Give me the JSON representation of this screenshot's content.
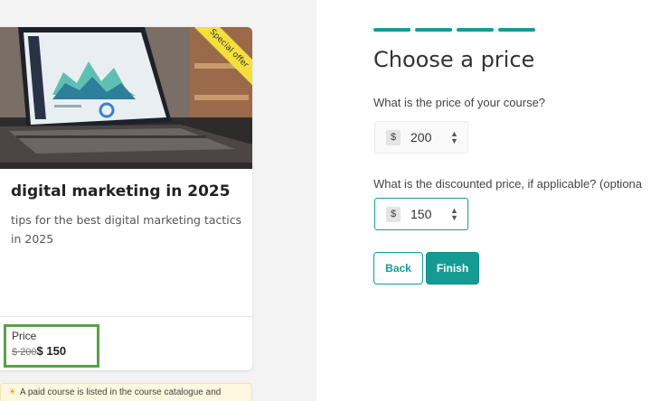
{
  "course_card": {
    "ribbon": "Special offer",
    "title": "digital marketing in 2025",
    "description": "tips for the best digital marketing tactics in 2025",
    "price_label": "Price",
    "original_price": "$ 200",
    "discounted_price": "$ 150",
    "notice": "A paid course is listed in the course catalogue and"
  },
  "form": {
    "title": "Choose a price",
    "price_question": "What is the price of your course?",
    "discount_question": "What is the discounted price, if applicable? (optiona",
    "price": {
      "currency": "$",
      "value": "200"
    },
    "discount": {
      "currency": "$",
      "value": "150"
    },
    "back_label": "Back",
    "finish_label": "Finish",
    "steps": [
      "step-1",
      "step-2",
      "step-3",
      "step-4"
    ],
    "step_color": "#149c94"
  },
  "colors": {
    "accent": "#149c94",
    "highlight_border": "#5aa047",
    "ribbon": "#f4df3c"
  },
  "icons": {
    "notice": "lightbulb-icon",
    "spinner": "spinner-arrows-icon"
  }
}
